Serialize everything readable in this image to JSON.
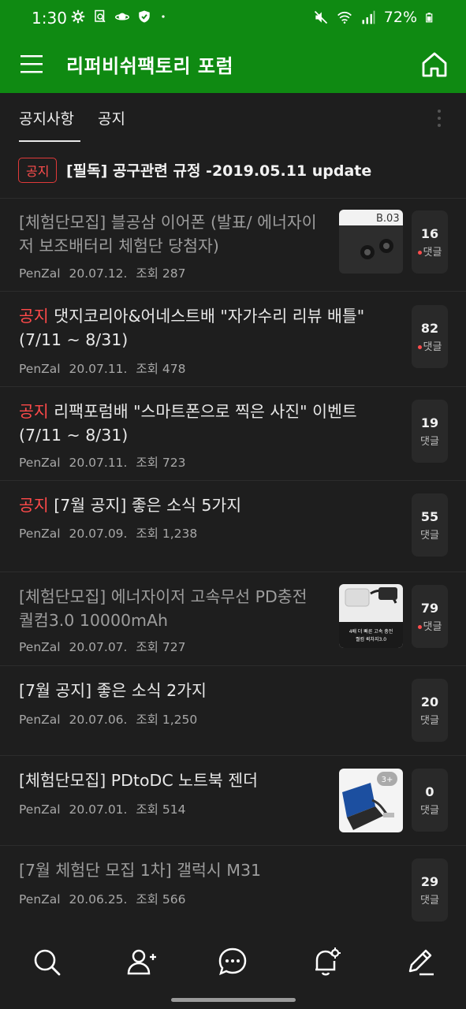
{
  "status_bar": {
    "time": "1:30",
    "battery": "72%"
  },
  "header": {
    "title": "리퍼비쉬팩토리 포럼"
  },
  "tabs": [
    {
      "label": "공지사항"
    },
    {
      "label": "공지"
    }
  ],
  "pinned": {
    "badge": "공지",
    "title": "[필독] 공구관련 규정 -2019.05.11 update"
  },
  "posts": [
    {
      "tag": "",
      "title": "[체험단모집] 블공삼 이어폰 (발표/ 에너자이저 보조배터리 체험단 당첨자)",
      "author": "PenZal",
      "date": "20.07.12.",
      "views": "조회 287",
      "comments": "16",
      "comments_label": "댓글",
      "thumb_label": "B.03"
    },
    {
      "tag": "공지",
      "title": "댓지코리아&어네스트배 \"자가수리 리뷰 배틀\" (7/11 ~ 8/31)",
      "author": "PenZal",
      "date": "20.07.11.",
      "views": "조회 478",
      "comments": "82",
      "comments_label": "댓글"
    },
    {
      "tag": "공지",
      "title": "리팩포럼배 \"스마트폰으로 찍은 사진\" 이벤트(7/11 ~ 8/31)",
      "author": "PenZal",
      "date": "20.07.11.",
      "views": "조회 723",
      "comments": "19",
      "comments_label": "댓글"
    },
    {
      "tag": "공지",
      "title": "[7월 공지] 좋은 소식 5가지",
      "author": "PenZal",
      "date": "20.07.09.",
      "views": "조회 1,238",
      "comments": "55",
      "comments_label": "댓글"
    },
    {
      "tag": "",
      "title": "[체험단모집] 에너자이저 고속무선 PD충전 퀄컴3.0 10000mAh",
      "author": "PenZal",
      "date": "20.07.07.",
      "views": "조회 727",
      "comments": "79",
      "comments_label": "댓글",
      "thumb_caption1": "4배 더 빠른 고속 충전",
      "thumb_caption2": "퀄컴 퀵차지3.0"
    },
    {
      "tag": "",
      "title": "[7월 공지] 좋은 소식 2가지",
      "author": "PenZal",
      "date": "20.07.06.",
      "views": "조회 1,250",
      "comments": "20",
      "comments_label": "댓글"
    },
    {
      "tag": "",
      "title": "[체험단모집] PDtoDC 노트북 젠더",
      "author": "PenZal",
      "date": "20.07.01.",
      "views": "조회 514",
      "comments": "0",
      "comments_label": "댓글",
      "thumb_badge": "3+"
    },
    {
      "tag": "",
      "title": "[7월 체험단 모집 1차] 갤럭시 M31",
      "author": "PenZal",
      "date": "20.06.25.",
      "views": "조회 566",
      "comments": "29",
      "comments_label": "댓글"
    }
  ],
  "colors": {
    "app_bar": "#0f8a12",
    "background": "#1e1e1e",
    "notice_red": "#ff4a4a"
  }
}
